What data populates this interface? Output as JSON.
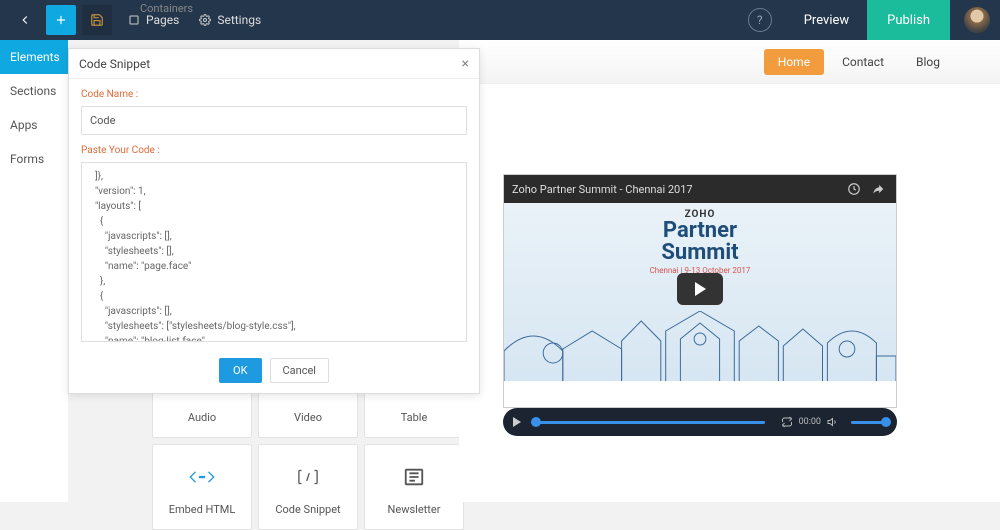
{
  "topbar": {
    "pages": "Pages",
    "settings": "Settings",
    "preview": "Preview",
    "publish": "Publish"
  },
  "leftnav": {
    "elements": "Elements",
    "sections": "Sections",
    "apps": "Apps",
    "forms": "Forms"
  },
  "panel": {
    "containers": "Containers"
  },
  "cards": {
    "audio": "Audio",
    "video": "Video",
    "table": "Table",
    "embed": "Embed HTML",
    "snippet": "Code Snippet",
    "newsletter": "Newsletter"
  },
  "modal": {
    "title": "Code Snippet",
    "label_name": "Code Name :",
    "name_value": "Code",
    "label_code": "Paste Your Code :",
    "code": "  ]},\n  \"version\": 1,\n  \"layouts\": [\n    {\n      \"javascripts\": [],\n      \"stylesheets\": [],\n      \"name\": \"page.face\"\n    },\n    {\n      \"javascripts\": [],\n      \"stylesheets\": [\"stylesheets/blog-style.css\"],\n      \"name\": \"blog-list.face\"\n    },\n    {\n      \"stylesheets\": [\"stylesheets/blog-style.css\"],\n      \"name\": \"blog-post.face\"",
    "ok": "OK",
    "cancel": "Cancel"
  },
  "site": {
    "home": "Home",
    "contact": "Contact",
    "blog": "Blog"
  },
  "video": {
    "title": "Zoho Partner Summit - Chennai 2017",
    "brand": "ZOHO",
    "line1": "Partner",
    "line2": "Summit",
    "sub": "Chennai  |  9-13 October 2017",
    "time": "00:00"
  }
}
